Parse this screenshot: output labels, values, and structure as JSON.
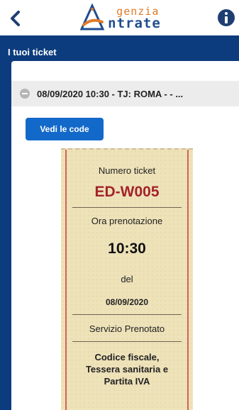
{
  "header": {
    "logo_top": "genzia",
    "logo_bottom": "ntrate",
    "back_icon": "chevron-left-icon",
    "info_icon": "info-icon"
  },
  "section": {
    "title": "I tuoi ticket"
  },
  "booking": {
    "summary": "08/09/2020 10:30 - TJ: ROMA - - ...",
    "view_queues_label": "Vedi le code"
  },
  "ticket": {
    "number_label": "Numero ticket",
    "number": "ED-W005",
    "time_label": "Ora prenotazione",
    "time": "10:30",
    "del_label": "del",
    "date": "08/09/2020",
    "service_label": "Servizio Prenotato",
    "service_line1": "Codice fiscale,",
    "service_line2": "Tessera sanitaria e",
    "service_line3": "Partita IVA"
  },
  "colors": {
    "brand_blue": "#0c3c7d",
    "button_blue": "#1369c9",
    "ticket_bg": "#eee2b9",
    "ticket_code": "#a3232b",
    "logo_orange": "#e07b2b"
  }
}
